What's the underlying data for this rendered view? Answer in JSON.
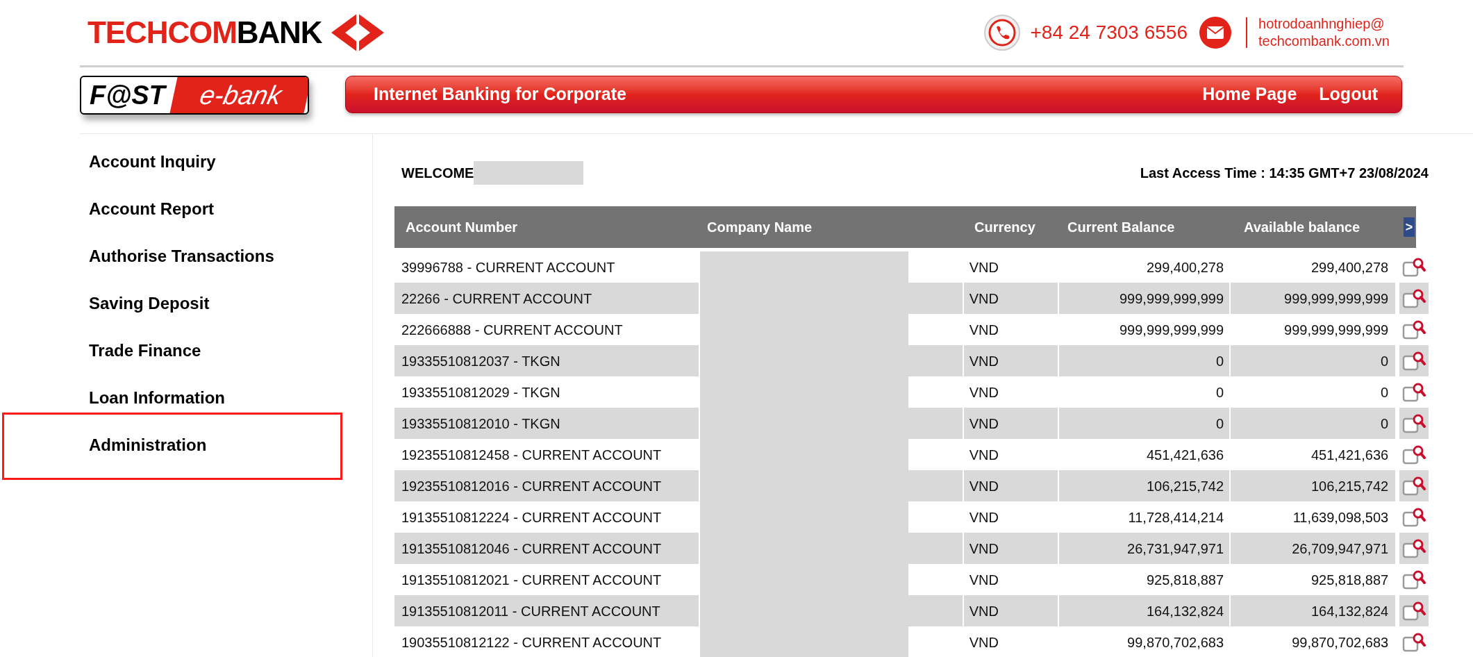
{
  "header": {
    "brand": {
      "part1": "TECHCOM",
      "part2": "BANK"
    },
    "phone": "+84 24 7303 6556",
    "email_lines": [
      "hotrodoanhnghiep@",
      "techcombank.com.vn"
    ]
  },
  "product_logo": {
    "part1": "F@ST",
    "part2": "e-bank"
  },
  "banner": {
    "title": "Internet Banking for Corporate",
    "links": [
      "Home Page",
      "Logout"
    ]
  },
  "sidebar": {
    "items": [
      {
        "label": "Account Inquiry",
        "highlighted": false
      },
      {
        "label": "Account Report",
        "highlighted": false
      },
      {
        "label": "Authorise Transactions",
        "highlighted": false
      },
      {
        "label": "Saving Deposit",
        "highlighted": false
      },
      {
        "label": "Trade Finance",
        "highlighted": false
      },
      {
        "label": "Loan Information",
        "highlighted": false
      },
      {
        "label": "Administration",
        "highlighted": true
      }
    ]
  },
  "welcome": "WELCOME",
  "last_access": "Last Access Time : 14:35 GMT+7 23/08/2024",
  "table": {
    "columns": [
      "Account Number",
      "Company Name",
      "Currency",
      "Current Balance",
      "Available balance"
    ],
    "scroll_button": ">",
    "rows": [
      {
        "account": "39996788 - CURRENT ACCOUNT",
        "currency": "VND",
        "current_balance": "299,400,278",
        "available_balance": "299,400,278"
      },
      {
        "account": "22266 - CURRENT ACCOUNT",
        "currency": "VND",
        "current_balance": "999,999,999,999",
        "available_balance": "999,999,999,999"
      },
      {
        "account": "222666888 - CURRENT ACCOUNT",
        "currency": "VND",
        "current_balance": "999,999,999,999",
        "available_balance": "999,999,999,999"
      },
      {
        "account": "19335510812037 - TKGN",
        "currency": "VND",
        "current_balance": "0",
        "available_balance": "0"
      },
      {
        "account": "19335510812029 - TKGN",
        "currency": "VND",
        "current_balance": "0",
        "available_balance": "0"
      },
      {
        "account": "19335510812010 - TKGN",
        "currency": "VND",
        "current_balance": "0",
        "available_balance": "0"
      },
      {
        "account": "19235510812458 - CURRENT ACCOUNT",
        "currency": "VND",
        "current_balance": "451,421,636",
        "available_balance": "451,421,636"
      },
      {
        "account": "19235510812016 - CURRENT ACCOUNT",
        "currency": "VND",
        "current_balance": "106,215,742",
        "available_balance": "106,215,742"
      },
      {
        "account": "19135510812224 - CURRENT ACCOUNT",
        "currency": "VND",
        "current_balance": "11,728,414,214",
        "available_balance": "11,639,098,503"
      },
      {
        "account": "19135510812046 - CURRENT ACCOUNT",
        "currency": "VND",
        "current_balance": "26,731,947,971",
        "available_balance": "26,709,947,971"
      },
      {
        "account": "19135510812021 - CURRENT ACCOUNT",
        "currency": "VND",
        "current_balance": "925,818,887",
        "available_balance": "925,818,887"
      },
      {
        "account": "19135510812011 - CURRENT ACCOUNT",
        "currency": "VND",
        "current_balance": "164,132,824",
        "available_balance": "164,132,824"
      },
      {
        "account": "19035510812122 - CURRENT ACCOUNT",
        "currency": "VND",
        "current_balance": "99,870,702,683",
        "available_balance": "99,870,702,683"
      }
    ]
  }
}
